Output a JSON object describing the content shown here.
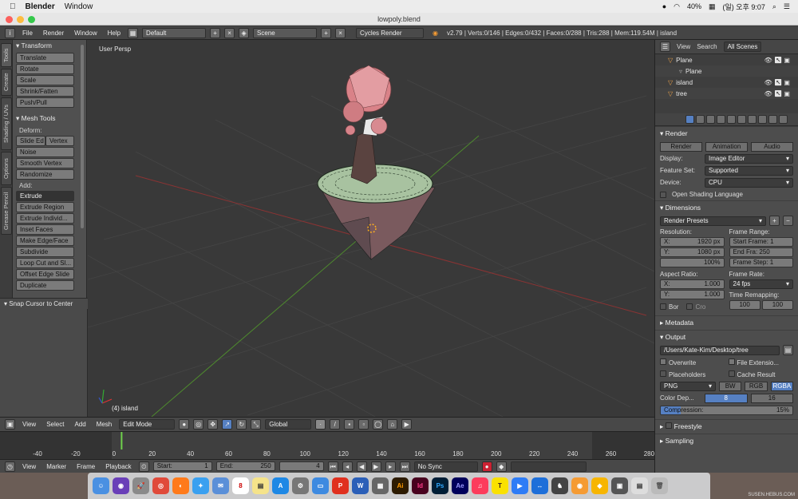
{
  "macbar": {
    "app": "Blender",
    "menu": "Window",
    "battery": "40%",
    "clock": "(일) 오후 9:07"
  },
  "window": {
    "title": "lowpoly.blend"
  },
  "topheader": {
    "menus": [
      "File",
      "Render",
      "Window",
      "Help"
    ],
    "layout": "Default",
    "scene": "Scene",
    "engine": "Cycles Render",
    "stats": "v2.79 | Verts:0/146 | Edges:0/432 | Faces:0/288 | Tris:288 | Mem:119.54M | island"
  },
  "vtabs": [
    "Tools",
    "Create",
    "Shading / UVs",
    "Options",
    "Grease Pencil"
  ],
  "tools": {
    "transform_title": "Transform",
    "transform": [
      "Translate",
      "Rotate",
      "Scale",
      "Shrink/Fatten",
      "Push/Pull"
    ],
    "mesh_title": "Mesh Tools",
    "deform_label": "Deform:",
    "deform_row": [
      "Slide Ed",
      "Vertex"
    ],
    "deform": [
      "Noise",
      "Smooth Vertex",
      "Randomize"
    ],
    "add_label": "Add:",
    "add_selected": "Extrude",
    "add": [
      "Extrude Region",
      "Extrude Individ...",
      "Inset Faces",
      "Make Edge/Face",
      "Subdivide",
      "Loop Cut and Sl...",
      "Offset Edge Slide",
      "Duplicate"
    ],
    "snap": "Snap Cursor to Center"
  },
  "viewport": {
    "label": "User Persp",
    "object": "(4) island"
  },
  "vheader": {
    "menus": [
      "View",
      "Select",
      "Add",
      "Mesh"
    ],
    "mode": "Edit Mode",
    "orientation": "Global"
  },
  "timeline": {
    "ticks": [
      "-40",
      "-20",
      "0",
      "20",
      "40",
      "60",
      "80",
      "100",
      "120",
      "140",
      "160",
      "180",
      "200",
      "220",
      "240",
      "260",
      "280"
    ],
    "current_frame": 4
  },
  "theader": {
    "menus": [
      "View",
      "Marker",
      "Frame",
      "Playback"
    ],
    "start_label": "Start:",
    "start": "1",
    "end_label": "End:",
    "end": "250",
    "frame": "4",
    "sync": "No Sync"
  },
  "outliner": {
    "tabs": [
      "View",
      "Search",
      "All Scenes"
    ],
    "rows": [
      {
        "name": "Plane",
        "level": 0
      },
      {
        "name": "Plane",
        "level": 1
      },
      {
        "name": "island",
        "level": 0
      },
      {
        "name": "tree",
        "level": 0
      }
    ]
  },
  "props": {
    "render_title": "Render",
    "render_buttons": [
      "Render",
      "Animation",
      "Audio"
    ],
    "display_label": "Display:",
    "display": "Image Editor",
    "featureset_label": "Feature Set:",
    "featureset": "Supported",
    "device_label": "Device:",
    "device": "CPU",
    "osl": "Open Shading Language",
    "dimensions_title": "Dimensions",
    "presets": "Render Presets",
    "resolution_label": "Resolution:",
    "res_x": "1920 px",
    "res_y": "1080 px",
    "res_pct": "100%",
    "framerange_label": "Frame Range:",
    "start_frame": "Start Frame: 1",
    "end_frame": "End Fra: 250",
    "frame_step": "Frame Step: 1",
    "aspect_label": "Aspect Ratio:",
    "asp_x": "1.000",
    "asp_y": "1.000",
    "framerate_label": "Frame Rate:",
    "framerate": "24 fps",
    "remap_label": "Time Remapping:",
    "remap_old": "100",
    "remap_new": "100",
    "bor": "Bor",
    "cro": "Cro",
    "metadata_title": "Metadata",
    "output_title": "Output",
    "output_path": "/Users/Kate-Kim/Desktop/tree",
    "overwrite": "Overwrite",
    "file_ext": "File Extensio...",
    "placeholders": "Placeholders",
    "cache": "Cache Result",
    "format": "PNG",
    "color_modes": [
      "BW",
      "RGB",
      "RGBA"
    ],
    "color_depth_label": "Color Dep...",
    "color_depth": [
      "8",
      "16"
    ],
    "compression_label": "Compression:",
    "compression": "15%",
    "freestyle": "Freestyle",
    "sampling": "Sampling"
  },
  "dock": {
    "watermark": "SUSEN.HEBUS.COM"
  }
}
